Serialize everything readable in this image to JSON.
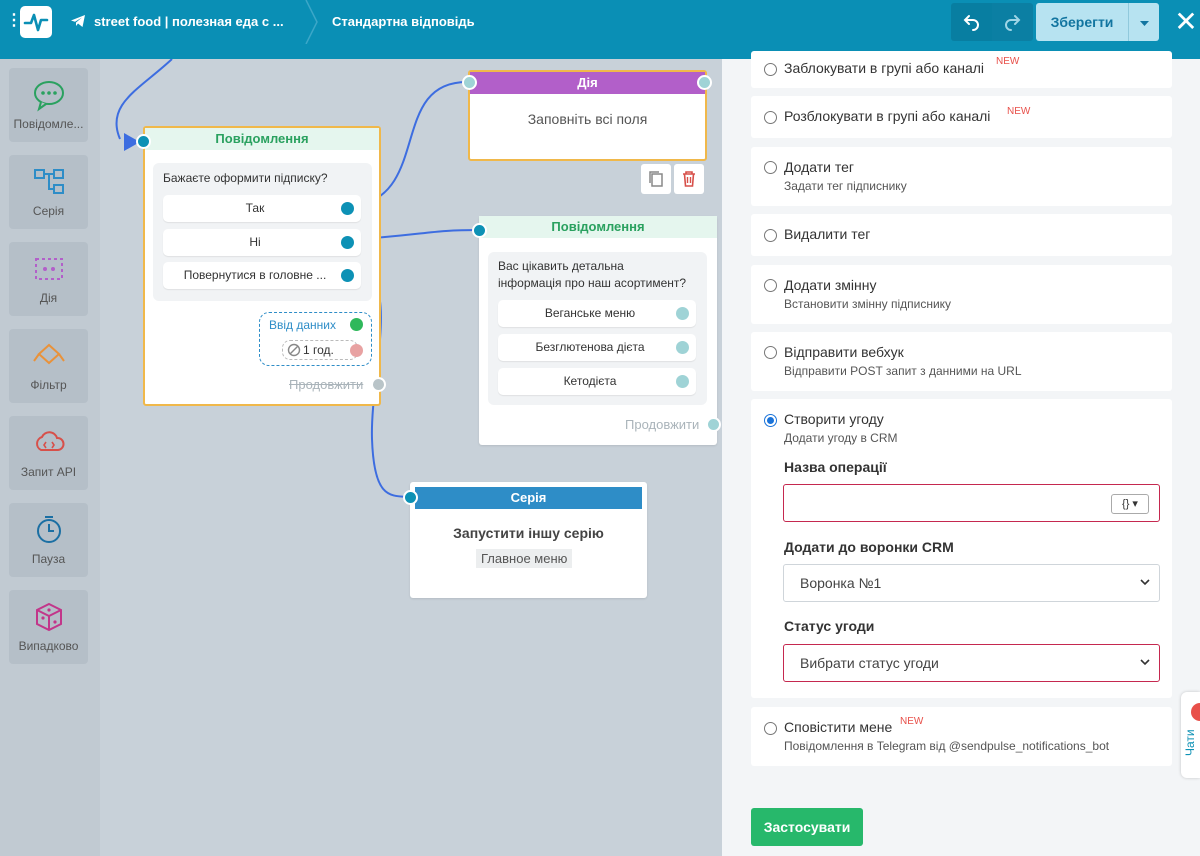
{
  "topbar": {
    "bot_name": "street food | полезная еда с ...",
    "flow_name": "Стандартна відповідь",
    "save_label": "Зберегти",
    "close_label": "✕"
  },
  "palette": [
    {
      "label": "Повідомле...",
      "icon": "message-icon"
    },
    {
      "label": "Серія",
      "icon": "series-icon"
    },
    {
      "label": "Дія",
      "icon": "action-icon"
    },
    {
      "label": "Фільтр",
      "icon": "filter-icon"
    },
    {
      "label": "Запит API",
      "icon": "api-request-icon"
    },
    {
      "label": "Пауза",
      "icon": "pause-clock-icon"
    },
    {
      "label": "Випадково",
      "icon": "random-dice-icon"
    }
  ],
  "canvas": {
    "msg1": {
      "title": "Повідомлення",
      "question": "Бажаєте оформити підписку?",
      "buttons": [
        "Так",
        "Ні",
        "Повернутися в головне ..."
      ],
      "input_label": "Ввід данних",
      "timeout": "1 год.",
      "continue": "Продовжити"
    },
    "action": {
      "title": "Дія",
      "placeholder": "Заповніть всі поля"
    },
    "msg2": {
      "title": "Повідомлення",
      "question_line1": "Вас цікавить детальна",
      "question_line2": "інформація про наш асортимент?",
      "buttons": [
        "Веганське меню",
        "Безглютенова дієта",
        "Кетодієта"
      ],
      "continue": "Продовжити"
    },
    "series": {
      "title": "Серія",
      "label": "Запустити іншу серію",
      "tag": "Главное меню"
    }
  },
  "panel": {
    "options": [
      {
        "title": "Заблокувати в групі або каналі",
        "new": "NEW"
      },
      {
        "title": "Розблокувати в групі або каналі",
        "new": "NEW"
      },
      {
        "title": "Додати тег",
        "sub": "Задати тег підписнику"
      },
      {
        "title": "Видалити тег"
      },
      {
        "title": "Додати змінну",
        "sub": "Встановити змінну підписнику"
      },
      {
        "title": "Відправити вебхук",
        "sub": "Відправити POST запит з данними на URL"
      },
      {
        "title": "Створити угоду",
        "sub": "Додати угоду в CRM"
      },
      {
        "title": "Сповістити мене",
        "new": "NEW",
        "sub": "Повідомлення в Telegram від @sendpulse_notifications_bot"
      }
    ],
    "deal": {
      "name_label": "Назва операції",
      "var_btn": "{} ▾",
      "funnel_label": "Додати до воронки CRM",
      "funnel_value": "Воронка №1",
      "status_label": "Статус угоди",
      "status_value": "Вибрати статус угоди"
    },
    "apply_label": "Застосувати",
    "chat_tab": "Чати"
  },
  "colors": {
    "topbar": "#0a8fb5",
    "message_header": "#2aa15f",
    "action_header": "#b25fc9",
    "series_header": "#2e8dc7",
    "apply": "#27b86b",
    "error_border": "#c5284f",
    "new_badge": "#e8504a"
  }
}
